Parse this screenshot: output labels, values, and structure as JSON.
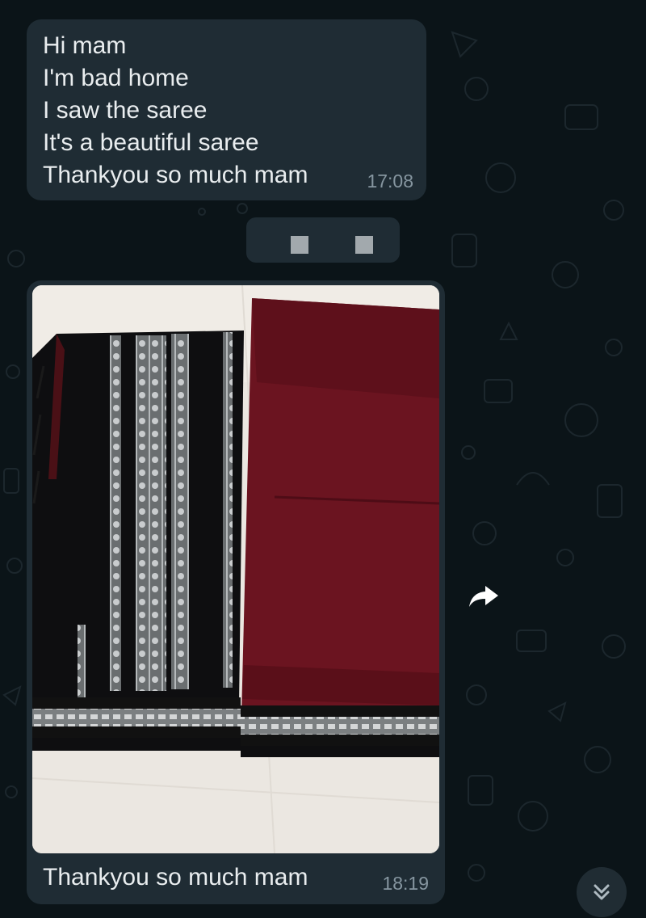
{
  "chat": {
    "messages": [
      {
        "lines": [
          "Hi mam",
          "I'm bad home",
          "I saw the saree",
          "It's a beautiful saree",
          "Thankyou so much mam"
        ],
        "time": "17:08"
      },
      {
        "caption": "Thankyou so much mam",
        "time": "18:19"
      }
    ]
  },
  "icons": {
    "forward": "forward-icon",
    "scroll_down": "double-chevron-down-icon"
  },
  "colors": {
    "background": "#0b1418",
    "bubble": "#1f2c34",
    "text": "#e9edef",
    "timestamp": "#8696a0"
  }
}
